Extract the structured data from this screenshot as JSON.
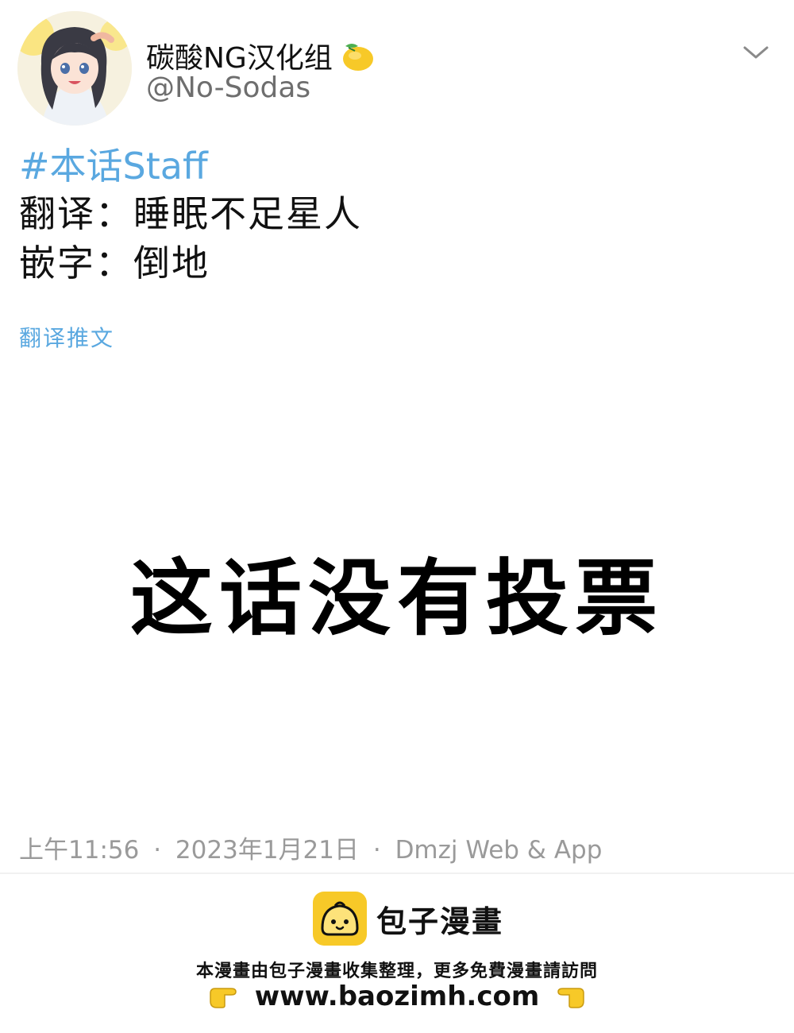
{
  "user": {
    "display_name": "碳酸NG汉化组",
    "handle": "@No-Sodas",
    "avatar_icon": "anime-girl-avatar",
    "name_emoji_icon": "lemon-icon"
  },
  "tweet": {
    "hashtag": "#本话Staff",
    "lines": [
      "翻译：睡眠不足星人",
      "嵌字：倒地"
    ],
    "translate_link": "翻译推文"
  },
  "notice": "这话没有投票",
  "meta": {
    "time": "上午11:56",
    "date": "2023年1月21日",
    "source": "Dmzj Web & App",
    "separator": "·"
  },
  "watermark": {
    "brand_name": "包子漫畫",
    "promo_text": "本漫畫由包子漫畫收集整理，更多免費漫畫請訪問",
    "url": "www.baozimh.com"
  },
  "colors": {
    "link_blue": "#5aa8e0",
    "muted_gray": "#9a9a9a",
    "brand_yellow": "#f7c928"
  }
}
